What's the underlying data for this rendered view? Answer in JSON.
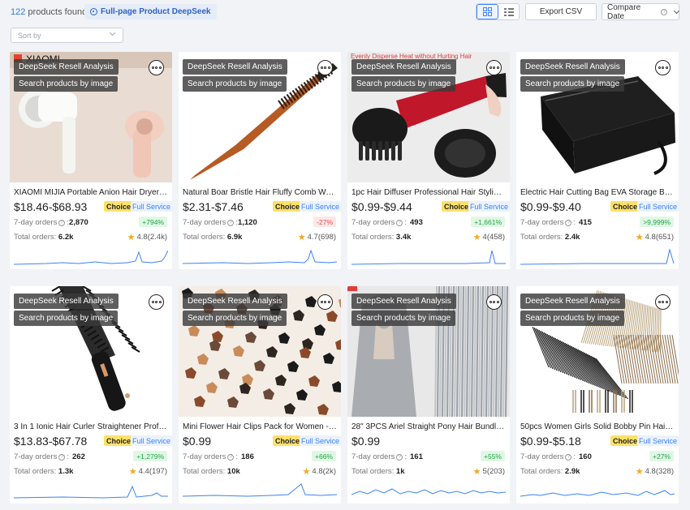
{
  "header": {
    "count": "122",
    "count_suffix": "products found",
    "deepseek_label": "Full-page Product DeepSeek",
    "export_label": "Export CSV",
    "compare_label": "Compare Date"
  },
  "sort": {
    "placeholder": "Sort by"
  },
  "card_labels": {
    "resell": "DeepSeek Resell Analysis",
    "search_image": "Search products by image",
    "orders_7day": "7-day orders",
    "total_orders": "Total orders:",
    "choice": "Choice",
    "full_service": "Full Service"
  },
  "colors": {
    "accent": "#3b82f6",
    "choice": "#fce16a",
    "positive": "#22a447",
    "negative": "#e24b4b"
  },
  "products": [
    {
      "title": "XIAOMI MIJIA Portable Anion Hair Dryer H10...",
      "price": "$18.46-$68.93",
      "choice": true,
      "full_service": true,
      "orders_7day": "2,870",
      "change": "+794%",
      "trend": "up",
      "total": "6.2k",
      "rating": "4.8(2.4k)",
      "image_label": "XIAOMI",
      "image_subject": "hair-dryer"
    },
    {
      "title": "Natural Boar Bristle Hair Fluffy Comb Wood ...",
      "price": "$2.31-$7.46",
      "choice": true,
      "full_service": true,
      "orders_7day": "1,120",
      "change": "-27%",
      "trend": "down",
      "total": "6.9k",
      "rating": "4.7(698)",
      "image_subject": "comb"
    },
    {
      "title": "1pc Hair Diffuser Professional Hair Styling C...",
      "price": "$0.99-$9.44",
      "choice": true,
      "full_service": true,
      "orders_7day": "493",
      "change": "+1,661%",
      "trend": "up",
      "total": "3.4k",
      "rating": "4(458)",
      "image_subject": "diffuser"
    },
    {
      "title": "Electric Hair Cutting Bag EVA Storage Box H...",
      "price": "$0.99-$9.40",
      "choice": true,
      "full_service": true,
      "orders_7day": "415",
      "change": ">9,999%",
      "trend": "up",
      "total": "2.4k",
      "rating": "4.8(651)",
      "image_subject": "storage-case"
    },
    {
      "title": "3 In 1 Ionic Hair Curler Straightener Professi...",
      "price": "$13.83-$67.78",
      "choice": true,
      "full_service": true,
      "orders_7day": "262",
      "change": "+1,279%",
      "trend": "up",
      "total": "1.3k",
      "rating": "4.4(197)",
      "image_subject": "curling-brush"
    },
    {
      "title": "Mini Flower Hair Clips Pack for Women - Cre...",
      "price": "$0.99",
      "choice": true,
      "full_service": true,
      "orders_7day": "186",
      "change": "+66%",
      "trend": "up",
      "total": "10k",
      "rating": "4.8(2k)",
      "image_subject": "hair-clips"
    },
    {
      "title": "28\" 3PCS Ariel Straight Pony Hair Bundles C...",
      "price": "$0.99",
      "choice": false,
      "full_service": false,
      "orders_7day": "161",
      "change": "+55%",
      "trend": "up",
      "total": "1k",
      "rating": "5(203)",
      "image_subject": "hair-bundles"
    },
    {
      "title": "50pcs Women Girls Solid Bobby Pin Hair Cli...",
      "price": "$0.99-$5.18",
      "choice": true,
      "full_service": true,
      "orders_7day": "160",
      "change": "+27%",
      "trend": "up",
      "total": "2.9k",
      "rating": "4.8(328)",
      "image_subject": "bobby-pins"
    }
  ]
}
